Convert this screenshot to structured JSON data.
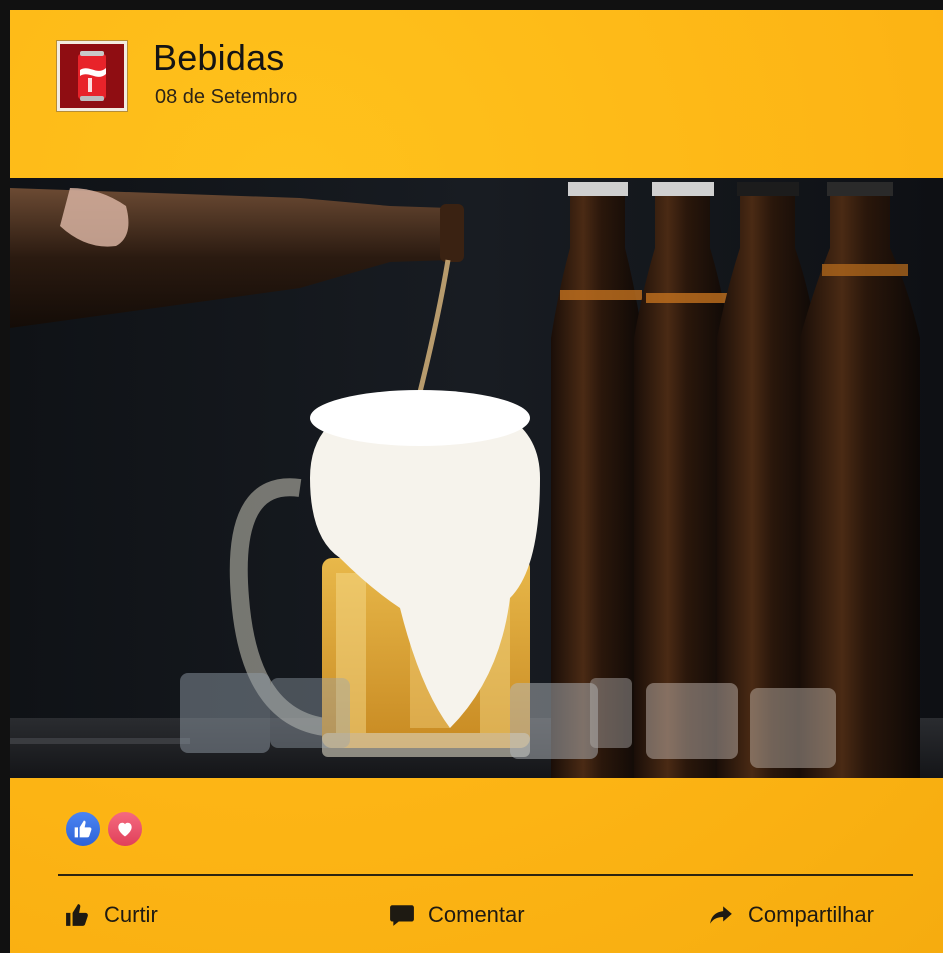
{
  "post": {
    "page_name": "Bebidas",
    "date": "08 de Setembro",
    "avatar_icon": "soda-can-icon",
    "image_alt": "Cerveja sendo servida em caneca com espuma, garrafas ao fundo e cubos de gelo"
  },
  "reactions": {
    "icons": [
      "like-icon",
      "heart-icon"
    ]
  },
  "actions": {
    "like_label": "Curtir",
    "comment_label": "Comentar",
    "share_label": "Compartilhar"
  },
  "colors": {
    "background": "#fdb515",
    "frame": "#111111",
    "like_blue": "#3b74e6",
    "love_pink": "#e74b63",
    "avatar_red": "#8f0d12"
  }
}
